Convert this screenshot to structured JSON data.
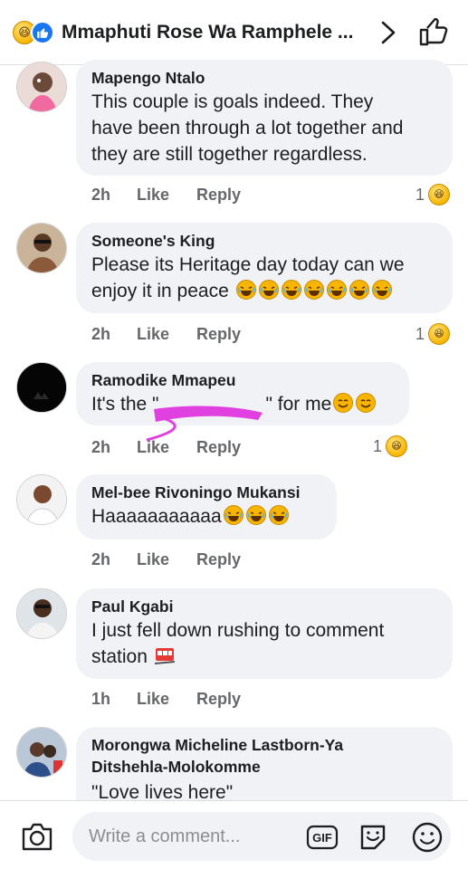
{
  "header": {
    "title": "Mmaphuti Rose Wa Ramphele ...",
    "reaction_icons": [
      "haha-emoji-icon",
      "like-reaction-icon"
    ],
    "like_color": "#1877f2"
  },
  "comments": [
    {
      "author": "Mapengo Ntalo",
      "lines": [
        "This couple is goals indeed. They",
        "have been through a lot together and",
        "they are still together regardless."
      ],
      "time": "2h",
      "like": "Like",
      "reply": "Reply",
      "reaction_count": "1"
    },
    {
      "author": "Someone's King",
      "lines": [
        "Please its Heritage day today can we",
        "enjoy it in peace"
      ],
      "trailing_emojis": 7,
      "time": "2h",
      "like": "Like",
      "reply": "Reply",
      "reaction_count": "1"
    },
    {
      "author": "Ramodike Mmapeu",
      "text_before": "It's the \"",
      "text_after": "\" for me",
      "trailing_emojis": 2,
      "time": "2h",
      "like": "Like",
      "reply": "Reply",
      "reaction_count": "1"
    },
    {
      "author": "Mel-bee Rivoningo Mukansi",
      "text": "Haaaaaaaaaaa",
      "trailing_emojis": 3,
      "time": "2h",
      "like": "Like",
      "reply": "Reply"
    },
    {
      "author": "Paul Kgabi",
      "lines": [
        "I just fell down rushing to comment",
        "station"
      ],
      "time": "1h",
      "like": "Like",
      "reply": "Reply"
    },
    {
      "author_lines": [
        "Morongwa Micheline Lastborn-Ya",
        "Ditshehla-Molokomme"
      ],
      "text": "\"Love lives here\""
    }
  ],
  "composer": {
    "placeholder": "Write a comment...",
    "gif_label": "GIF"
  },
  "colors": {
    "bubble": "#f0f2f5",
    "action_text": "#65676b",
    "scribble": "#e040e0",
    "emoji_yellow": "#f7b500"
  }
}
